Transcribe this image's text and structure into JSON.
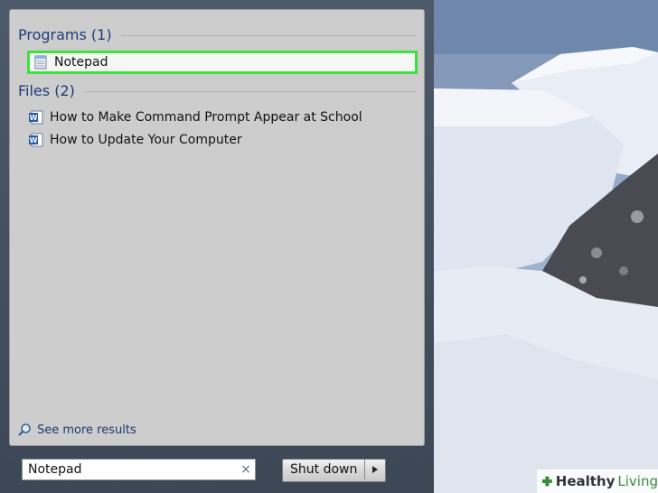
{
  "start_menu": {
    "programs_header": "Programs (1)",
    "programs": [
      {
        "label": "Notepad",
        "icon": "notepad-icon"
      }
    ],
    "files_header": "Files (2)",
    "files": [
      {
        "label": "How to Make Command Prompt Appear at School",
        "icon": "word-document-icon"
      },
      {
        "label": "How to Update Your Computer",
        "icon": "word-document-icon"
      }
    ],
    "see_more_label": "See more results",
    "search": {
      "value": "Notepad",
      "clear_glyph": "×"
    },
    "shutdown_label": "Shut down",
    "highlight_color": "#3ee23e"
  },
  "watermark": {
    "part1": "Healthy",
    "part2": "Living"
  }
}
